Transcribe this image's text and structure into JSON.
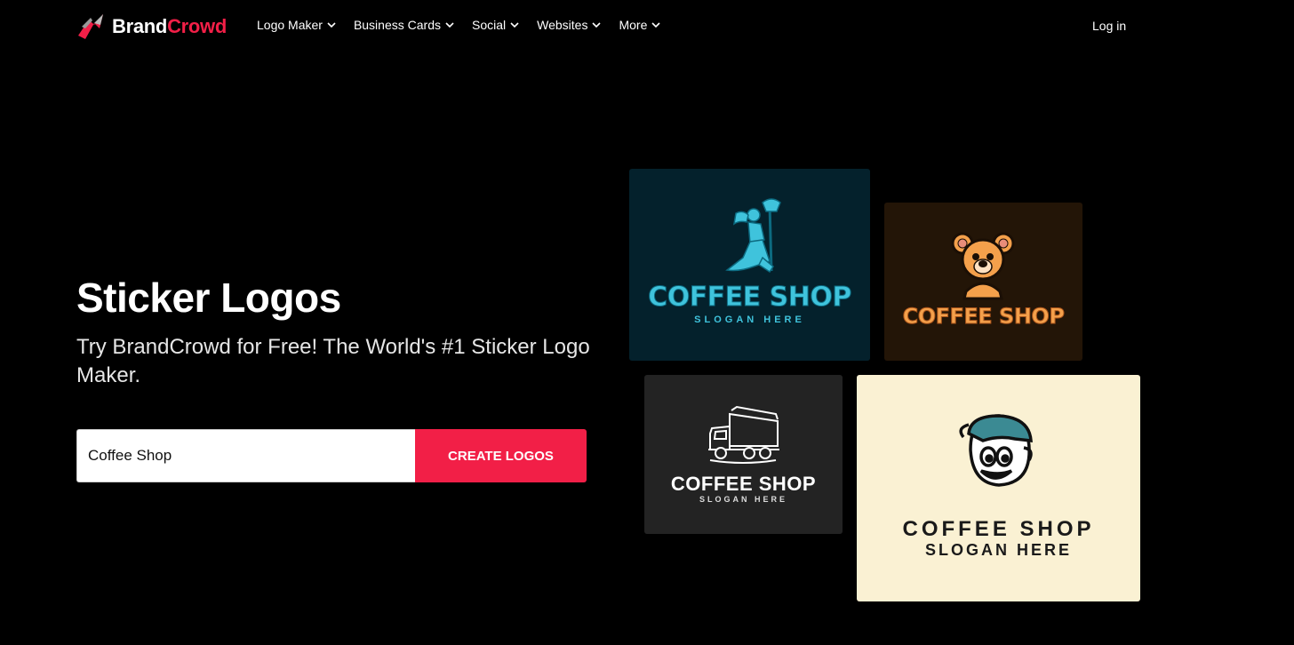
{
  "brand": {
    "name_part1": "Brand",
    "name_part2": "Crowd",
    "accent": "#f21f47"
  },
  "nav": {
    "items": [
      {
        "label": "Logo Maker"
      },
      {
        "label": "Business Cards"
      },
      {
        "label": "Social"
      },
      {
        "label": "Websites"
      },
      {
        "label": "More"
      }
    ],
    "login": "Log in"
  },
  "hero": {
    "title": "Sticker Logos",
    "subtitle": "Try BrandCrowd for Free! The World's #1 Sticker Logo Maker."
  },
  "search": {
    "value": "Coffee Shop",
    "button": "CREATE LOGOS"
  },
  "logos": [
    {
      "name": "COFFEE SHOP",
      "slogan": "SLOGAN HERE",
      "icon": "valkyrie-warrior-icon",
      "bg": "#04212c"
    },
    {
      "name": "COFFEE SHOP",
      "icon": "bear-mascot-icon",
      "bg": "#231507"
    },
    {
      "name": "COFFEE SHOP",
      "slogan": "SLOGAN HERE",
      "icon": "dump-truck-icon",
      "bg": "#232323"
    },
    {
      "name": "COFFEE SHOP",
      "slogan": "SLOGAN HERE",
      "icon": "cap-mascot-icon",
      "bg": "#faf1d3"
    }
  ]
}
